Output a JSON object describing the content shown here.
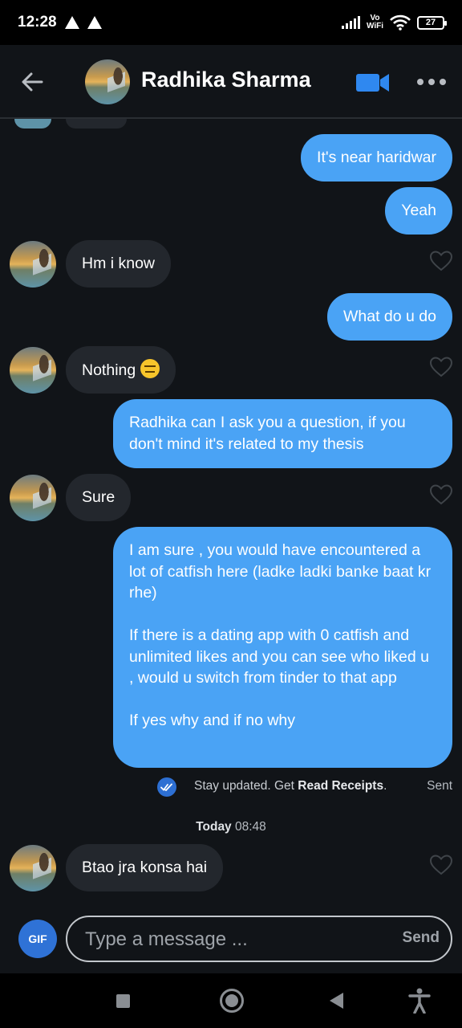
{
  "status_bar": {
    "time": "12:28",
    "network_label": "Vo\nWiFi",
    "battery": "27"
  },
  "header": {
    "contact_name": "Radhika Sharma"
  },
  "messages": [
    {
      "direction": "out",
      "text": "It's near haridwar"
    },
    {
      "direction": "out",
      "text": "Yeah"
    },
    {
      "direction": "in",
      "text": "Hm i know"
    },
    {
      "direction": "out",
      "text": "What do u do"
    },
    {
      "direction": "in",
      "text": "Nothing"
    },
    {
      "direction": "out",
      "text": "Radhika can I ask you a question, if you don't mind it's related to my thesis"
    },
    {
      "direction": "in",
      "text": "Sure"
    },
    {
      "direction": "out",
      "text": "I am sure , you would have encountered a lot of catfish here (ladke ladki banke baat kr rhe)\n\nIf there is a dating app with 0 catfish and unlimited likes and you can see who liked u , would u switch from tinder to that app\n\nIf yes why and if no why"
    },
    {
      "direction": "in",
      "text": "Btao jra konsa hai"
    }
  ],
  "receipt": {
    "prefix": "Stay updated. Get ",
    "link": "Read Receipts",
    "suffix": ".",
    "status": "Sent"
  },
  "date_divider": {
    "day": "Today",
    "time": "08:48"
  },
  "composer": {
    "gif_label": "GIF",
    "placeholder": "Type a message ...",
    "send_label": "Send"
  },
  "colors": {
    "outgoing_bubble": "#4aa3f5",
    "incoming_bubble": "#23272d",
    "background": "#111418",
    "accent": "#2f72d6"
  }
}
